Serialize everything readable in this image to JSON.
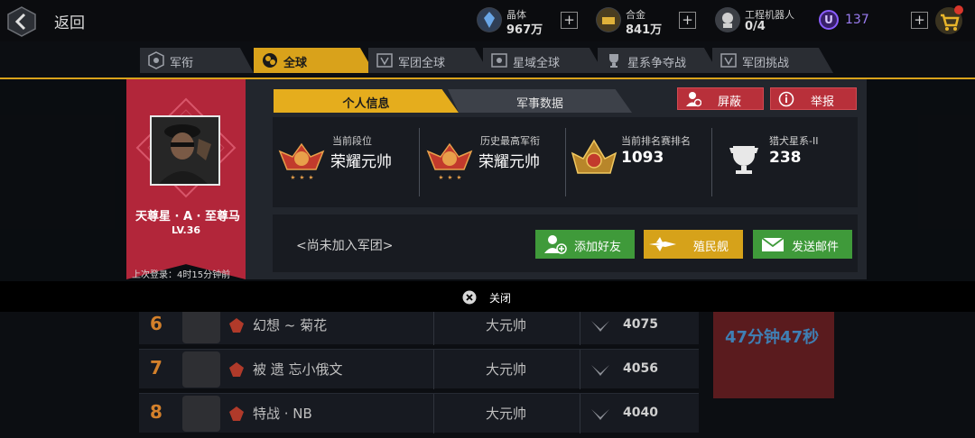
{
  "topbar": {
    "back_label": "返回",
    "resources": [
      {
        "icon": "crystal-icon",
        "name": "晶体",
        "value": "967万"
      },
      {
        "icon": "alloy-icon",
        "name": "合金",
        "value": "841万"
      },
      {
        "icon": "robot-icon",
        "name": "工程机器人",
        "value": "0/4"
      }
    ],
    "u_badge": "U",
    "u_value": "137"
  },
  "tabs": [
    {
      "label": "军衔",
      "icon": "rank-icon"
    },
    {
      "label": "全球",
      "icon": "global-icon",
      "active": true
    },
    {
      "label": "军团全球",
      "icon": "legion-icon"
    },
    {
      "label": "星域全球",
      "icon": "starfield-icon"
    },
    {
      "label": "星系争夺战",
      "icon": "trophy-icon"
    },
    {
      "label": "军团挑战",
      "icon": "legion-challenge-icon"
    }
  ],
  "background_list": {
    "rows": [
      {
        "rank": "6",
        "name": "幻想 ~ 菊花",
        "title": "大元帅",
        "score": "4075"
      },
      {
        "rank": "7",
        "name": "被 遗 忘小俄文",
        "title": "大元帅",
        "score": "4056"
      },
      {
        "rank": "8",
        "name": "特战 · NB",
        "title": "大元帅",
        "score": "4040"
      }
    ],
    "timer": "47分钟47秒"
  },
  "profile": {
    "name": "天尊星 · A · 至尊马",
    "level": "LV.36",
    "last_login": "上次登录：4时15分钟前",
    "tabs": [
      "个人信息",
      "军事数据"
    ],
    "block_label": "屏蔽",
    "report_label": "举报",
    "stats": [
      {
        "name": "当前段位",
        "value": "荣耀元帅"
      },
      {
        "name": "历史最高军衔",
        "value": "荣耀元帅"
      },
      {
        "name": "当前排名赛排名",
        "value": "1093"
      },
      {
        "name": "猎犬星系-II",
        "value": "238"
      }
    ],
    "no_legion": "<尚未加入军团>",
    "add_friend_label": "添加好友",
    "colony_ship_label": "殖民舰",
    "send_mail_label": "发送邮件",
    "close_label": "关闭"
  },
  "colors": {
    "accent": "#d9a21b",
    "banner_red": "#b2263a",
    "friend_green": "#3f9a3a",
    "colony_gold": "#d6a21a",
    "mail_green": "#3f9a3a"
  }
}
